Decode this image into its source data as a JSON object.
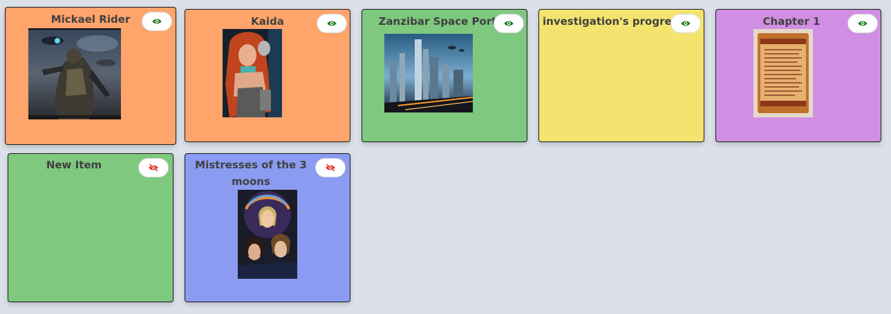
{
  "colors": {
    "orange": "#ffa46b",
    "green": "#7ec87f",
    "yellow": "#f4e46f",
    "purple": "#d08fe2",
    "blue": "#8a9bf1",
    "visible_icon": "#1e7a1e",
    "hidden_icon": "#e0201a"
  },
  "cards": [
    {
      "title": "Mickael Rider",
      "visibility": "visible",
      "visibility_icon": "eye-icon",
      "image": "armored-warrior-portrait"
    },
    {
      "title": "Kaida",
      "visibility": "visible",
      "visibility_icon": "eye-icon",
      "image": "red-haired-woman-portrait"
    },
    {
      "title": "Zanzibar Space Port",
      "visibility": "visible",
      "visibility_icon": "eye-icon",
      "image": "futuristic-city-skyline"
    },
    {
      "title": "investigation's progress",
      "visibility": "visible",
      "visibility_icon": "eye-icon",
      "image": null
    },
    {
      "title": "Chapter 1",
      "visibility": "visible",
      "visibility_icon": "eye-icon",
      "image": "ancient-scroll-document"
    },
    {
      "title": "New Item",
      "visibility": "hidden",
      "visibility_icon": "eye-slash-icon",
      "image": null
    },
    {
      "title": "Mistresses of the 3 moons",
      "visibility": "hidden",
      "visibility_icon": "eye-slash-icon",
      "image": "three-women-portrait"
    }
  ]
}
